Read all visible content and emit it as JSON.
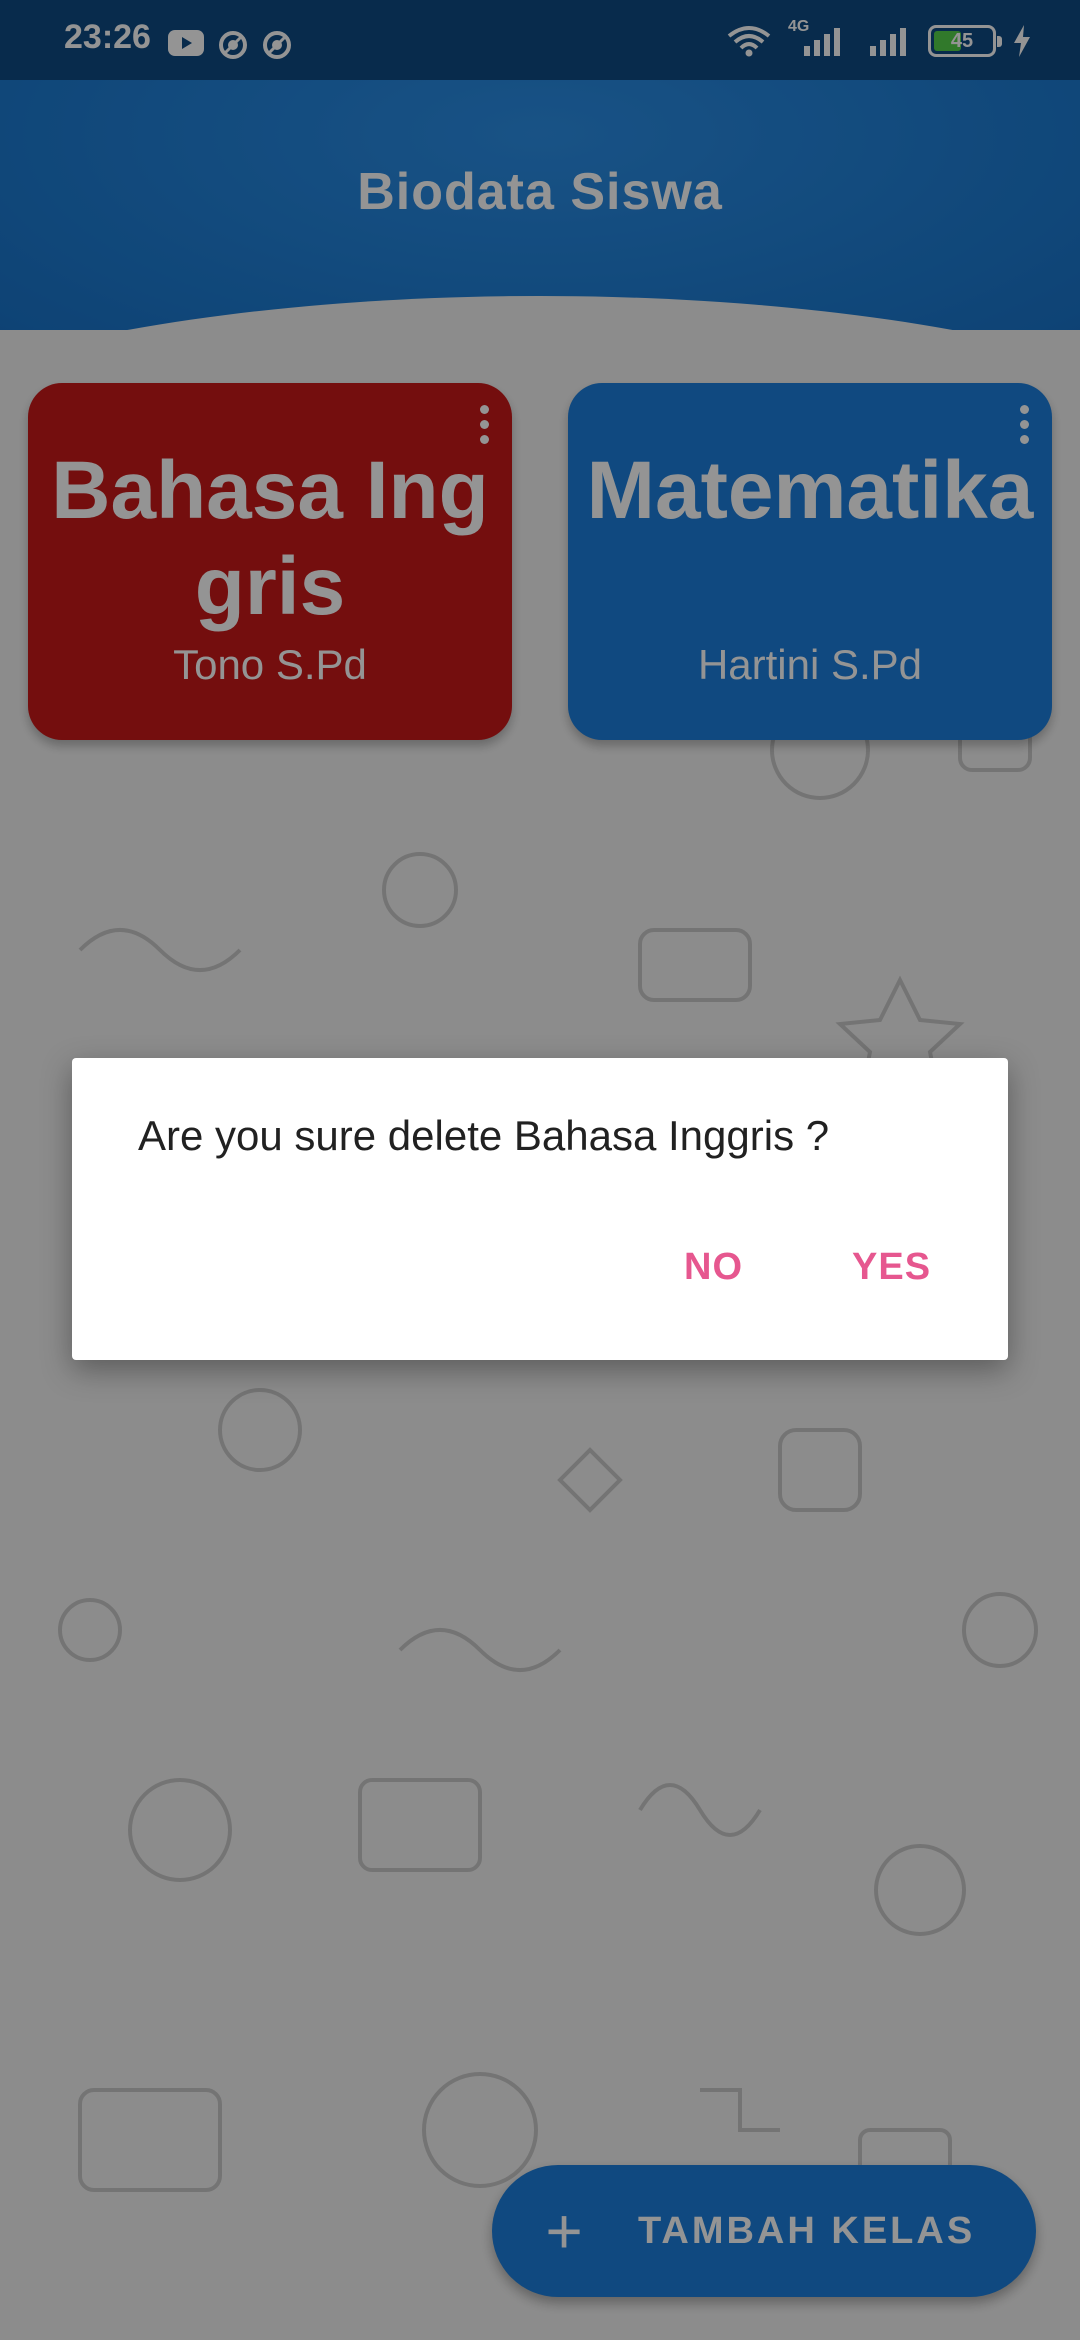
{
  "status_bar": {
    "time": "23:26",
    "left_icons": [
      "youtube-icon",
      "notification-icon",
      "notification-icon"
    ],
    "network_type": "4G",
    "battery_level": "45"
  },
  "app": {
    "title": "Biodata Siswa",
    "primary_color": "#1f7fd6"
  },
  "cards": [
    {
      "subject": "Bahasa Inggris",
      "teacher": "Tono S.Pd",
      "color": "#c81919"
    },
    {
      "subject": "Matematika",
      "teacher": "Hartini S.Pd",
      "color": "#1c7fdc"
    }
  ],
  "fab": {
    "label": "TAMBAH KELAS",
    "icon": "plus-icon"
  },
  "dialog": {
    "message": "Are you sure delete Bahasa Inggris ?",
    "no_label": "NO",
    "yes_label": "YES",
    "accent_color": "#e6578f"
  }
}
